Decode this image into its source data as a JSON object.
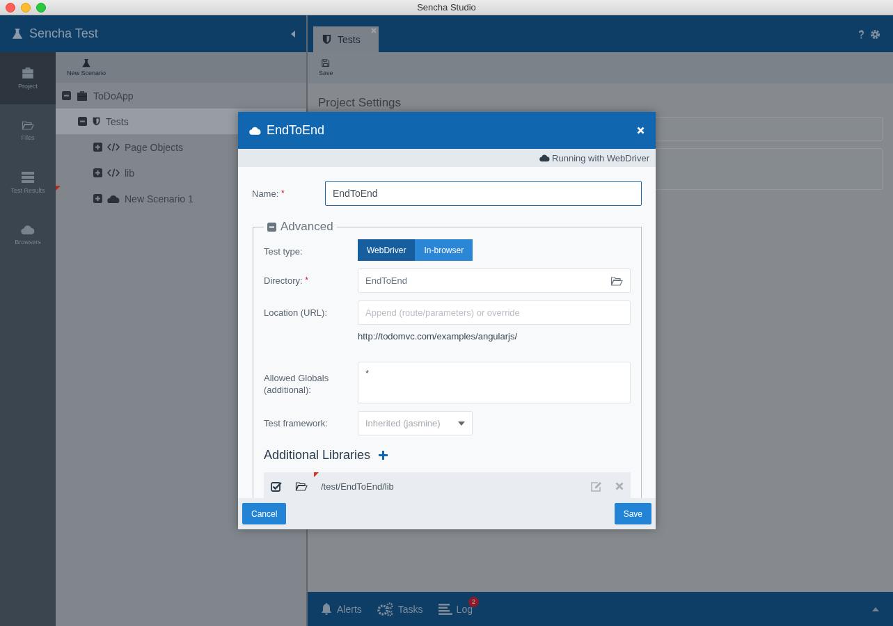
{
  "window": {
    "title": "Sencha Studio"
  },
  "app": {
    "title": "Sencha Test"
  },
  "nav": [
    {
      "label": "Project",
      "kind": "project",
      "selected": true
    },
    {
      "label": "Files",
      "kind": "files",
      "selected": false
    },
    {
      "label": "Test Results",
      "kind": "results",
      "selected": false
    },
    {
      "label": "Browsers",
      "kind": "browsers",
      "selected": false
    }
  ],
  "tree_toolbar": {
    "new_button": "New Scenario"
  },
  "tree": [
    {
      "label": "ToDoApp",
      "kind": "project",
      "expanded": true,
      "selected": false,
      "modified": false,
      "children": [
        {
          "label": "Tests",
          "kind": "suite",
          "expanded": true,
          "selected": true,
          "modified": false,
          "children": [
            {
              "label": "Page Objects",
              "kind": "code",
              "expanded": false,
              "selected": false,
              "modified": false
            },
            {
              "label": "lib",
              "kind": "code",
              "expanded": false,
              "selected": false,
              "modified": false
            },
            {
              "label": "New Scenario 1",
              "kind": "scenario",
              "expanded": false,
              "selected": false,
              "modified": true
            }
          ]
        }
      ]
    }
  ],
  "tabs": [
    {
      "label": "Tests",
      "selected": true
    }
  ],
  "toolbar": {
    "save": "Save"
  },
  "content": {
    "heading": "Project Settings"
  },
  "bottom_bar": [
    {
      "label": "Alerts",
      "kind": "alerts"
    },
    {
      "label": "Tasks",
      "kind": "tasks"
    },
    {
      "label": "Log",
      "kind": "log",
      "badge": "2"
    }
  ],
  "dialog": {
    "title": "EndToEnd",
    "status": "Running with WebDriver",
    "name": {
      "label": "Name:",
      "value": "EndToEnd",
      "required": true
    },
    "advanced": {
      "title": "Advanced",
      "expanded": true
    },
    "fields": [
      {
        "kind": "toggle",
        "label": "Test type:",
        "required": false,
        "options": [
          {
            "label": "WebDriver",
            "selected": true
          },
          {
            "label": "In-browser",
            "selected": false
          }
        ]
      },
      {
        "kind": "folder",
        "label": "Directory:",
        "required": true,
        "value": "EndToEnd"
      },
      {
        "kind": "url",
        "label": "Location (URL):",
        "required": false,
        "placeholder": "Append (route/parameters) or override",
        "hint": "http://todomvc.com/examples/angularjs/"
      },
      {
        "kind": "textarea",
        "label": "Allowed Globals (additional):",
        "required": false,
        "value": "*"
      },
      {
        "kind": "select",
        "label": "Test framework:",
        "required": false,
        "value": "Inherited (jasmine)"
      }
    ],
    "libraries_title": "Additional Libraries",
    "libraries": [
      {
        "path": "/test/EndToEnd/lib",
        "checked": true,
        "modified": true
      }
    ],
    "buttons": [
      {
        "label": "Cancel"
      },
      {
        "label": "Save"
      }
    ]
  }
}
